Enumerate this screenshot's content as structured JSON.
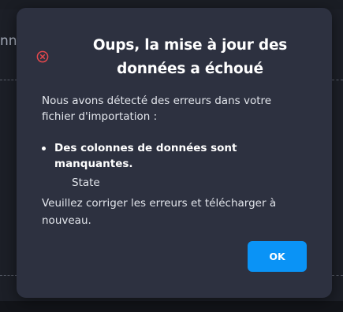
{
  "background": {
    "partial_text": "nn"
  },
  "dialog": {
    "title_line1": "Oups, la mise à jour des",
    "title_line2": "données a échoué",
    "icon": "error-circle-x-icon",
    "message_line1": "Nous avons détecté des erreurs dans votre",
    "message_line2": "fichier d'importation :",
    "errors": [
      {
        "label": "Des colonnes de données sont manquantes.",
        "details": [
          "State"
        ]
      }
    ],
    "footer_line1": "Veuillez corriger les erreurs et télécharger à",
    "footer_line2": "nouveau.",
    "ok_label": "OK"
  },
  "colors": {
    "modal_bg": "#2d3140",
    "page_bg": "#1c1f27",
    "accent": "#0a93f6",
    "error_red": "#e5484d",
    "text": "#e3e6ec"
  }
}
